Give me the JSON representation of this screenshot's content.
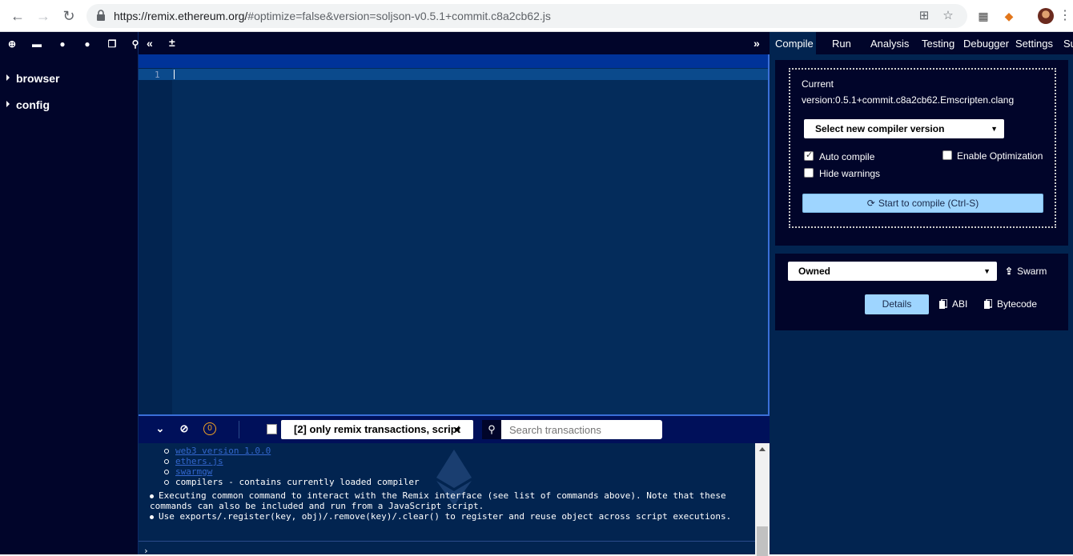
{
  "browser": {
    "url_host": "https://remix.ethereum.org/",
    "url_rest": "#optimize=false&version=soljson-v0.5.1+commit.c8a2cb62.js"
  },
  "filepanel": {
    "items": [
      {
        "label": "browser"
      },
      {
        "label": "config"
      }
    ]
  },
  "editor": {
    "line_number": "1"
  },
  "terminal": {
    "pending_count": "0",
    "filter_label": "[2] only remix transactions, script",
    "search_placeholder": "Search transactions",
    "sub_items": [
      {
        "text": "web3 version 1.0.0",
        "link": true
      },
      {
        "text": "ethers.js",
        "link": true
      },
      {
        "text": "swarmgw",
        "link": true
      },
      {
        "text": "compilers - contains currently loaded compiler",
        "link": false
      }
    ],
    "bullets": [
      "Executing common command to interact with the Remix interface (see list of commands above). Note that these commands can also be included and run from a JavaScript script.",
      "Use exports/.register(key, obj)/.remove(key)/.clear() to register and reuse object across script executions."
    ]
  },
  "rightpanel": {
    "tabs": [
      {
        "label": "Compile"
      },
      {
        "label": "Run"
      },
      {
        "label": "Analysis"
      },
      {
        "label": "Testing"
      },
      {
        "label": "Debugger"
      },
      {
        "label": "Settings"
      },
      {
        "label": "Su"
      }
    ],
    "compile": {
      "current_label": "Current",
      "version_text": "version:0.5.1+commit.c8a2cb62.Emscripten.clang",
      "select_label": "Select new compiler version",
      "auto_compile_label": "Auto compile",
      "auto_compile_checked": true,
      "enable_optimization_label": "Enable Optimization",
      "hide_warnings_label": "Hide warnings",
      "compile_button_label": "Start to compile (Ctrl-S)"
    },
    "contract": {
      "selected": "Owned",
      "swarm_label": "Swarm",
      "details_label": "Details",
      "abi_label": "ABI",
      "bytecode_label": "Bytecode"
    }
  },
  "colors": {
    "app_bg": "#021747",
    "panel_bg": "#01052a",
    "accent_blue": "#9ed5ff",
    "link": "#3366cc"
  }
}
